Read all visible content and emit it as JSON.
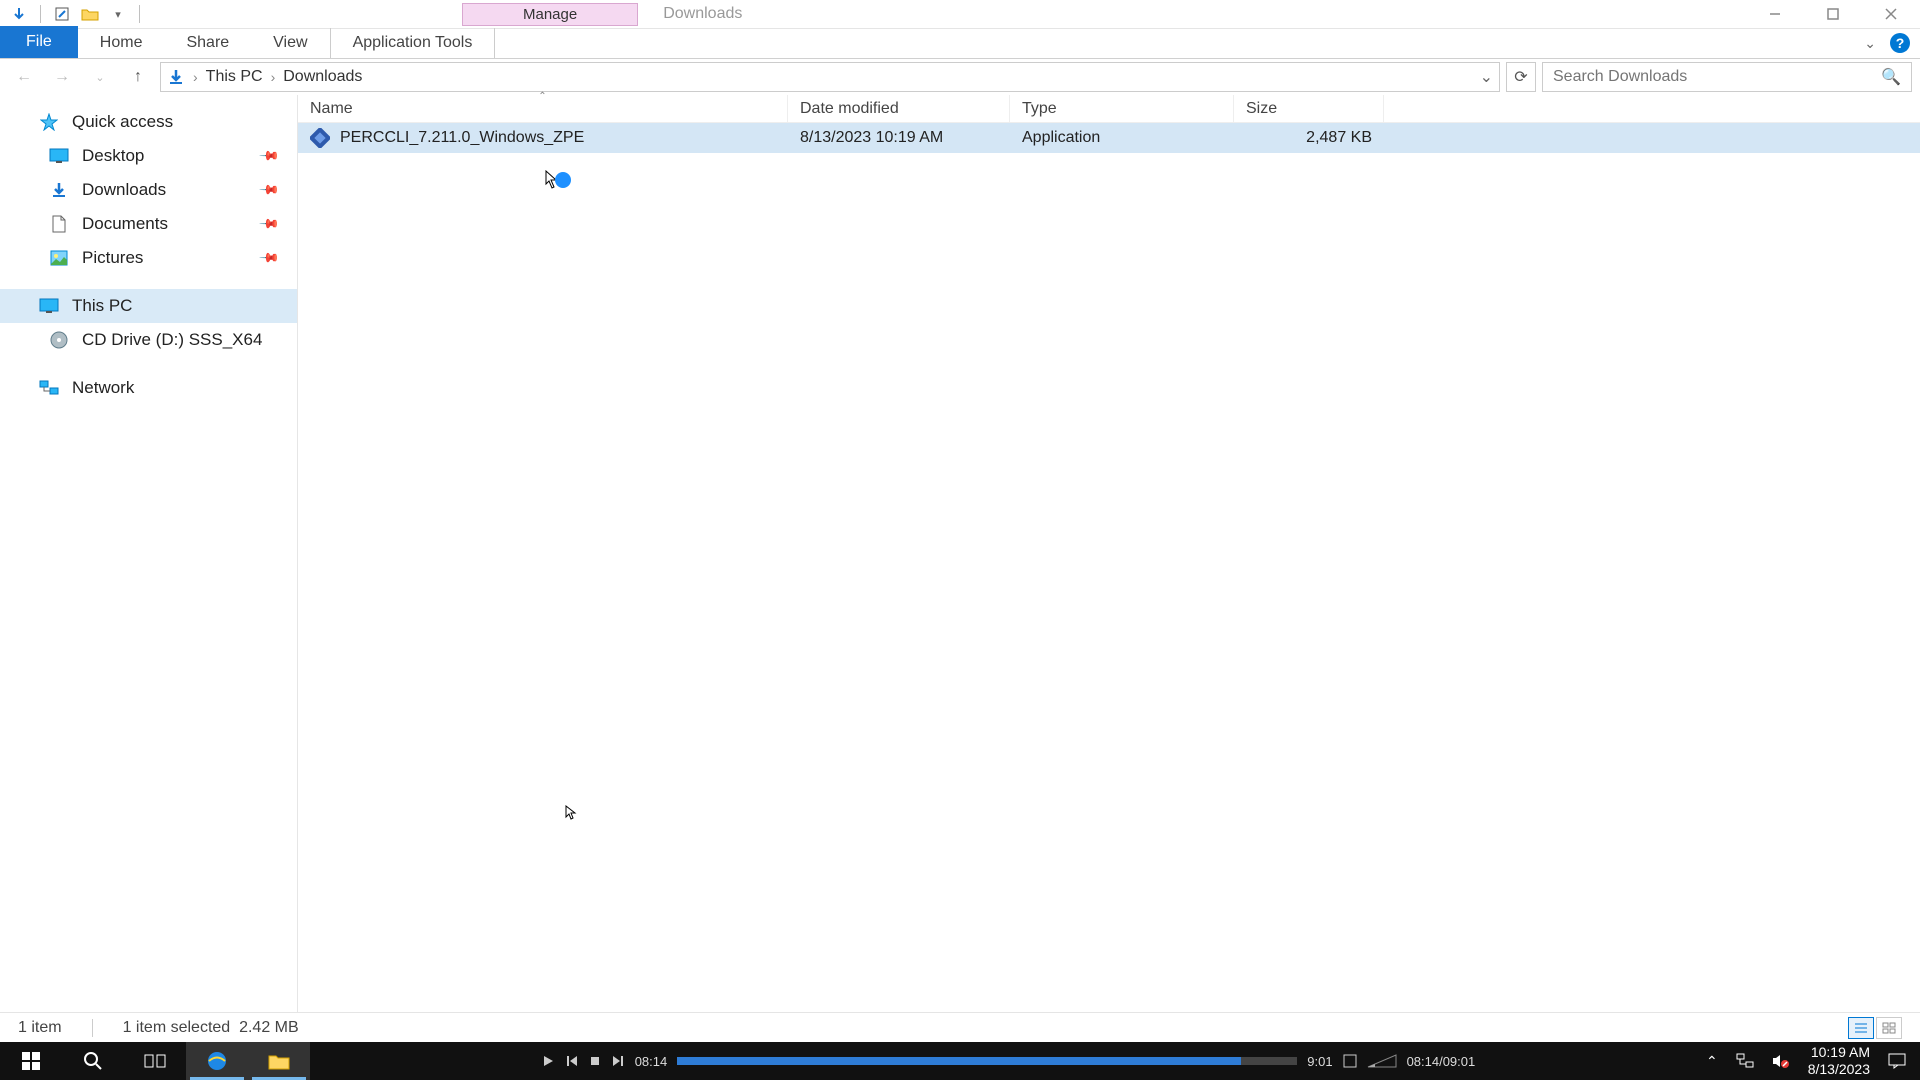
{
  "window": {
    "contextual_tab": "Manage",
    "title": "Downloads"
  },
  "ribbon": {
    "file": "File",
    "home": "Home",
    "share": "Share",
    "view": "View",
    "application_tools": "Application Tools"
  },
  "addressbar": {
    "root": "This PC",
    "folder": "Downloads"
  },
  "search": {
    "placeholder": "Search Downloads"
  },
  "sidebar": {
    "quick_access": "Quick access",
    "desktop": "Desktop",
    "downloads": "Downloads",
    "documents": "Documents",
    "pictures": "Pictures",
    "this_pc": "This PC",
    "cd_drive": "CD Drive (D:) SSS_X64",
    "network": "Network"
  },
  "columns": {
    "name": "Name",
    "date": "Date modified",
    "type": "Type",
    "size": "Size"
  },
  "files": [
    {
      "name": "PERCCLI_7.211.0_Windows_ZPE",
      "date": "8/13/2023 10:19 AM",
      "type": "Application",
      "size": "2,487 KB"
    }
  ],
  "statusbar": {
    "count": "1 item",
    "selection": "1 item selected",
    "size": "2.42 MB"
  },
  "media": {
    "pos": "08:14",
    "dur": "9:01",
    "pos_full": "08:14/09:01",
    "progress_pct": 91
  },
  "tray": {
    "time": "10:19 AM",
    "date": "8/13/2023"
  }
}
